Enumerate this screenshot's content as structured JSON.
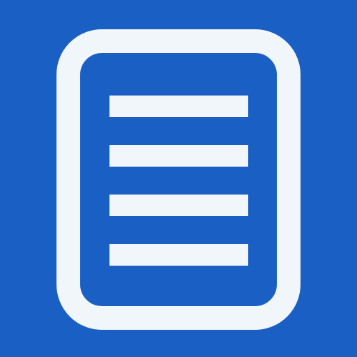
{
  "app_icon": {
    "icon": "document-icon",
    "line_count": 4,
    "colors": {
      "background": "#1a5fc3",
      "foreground": "#f1f6fa"
    }
  }
}
